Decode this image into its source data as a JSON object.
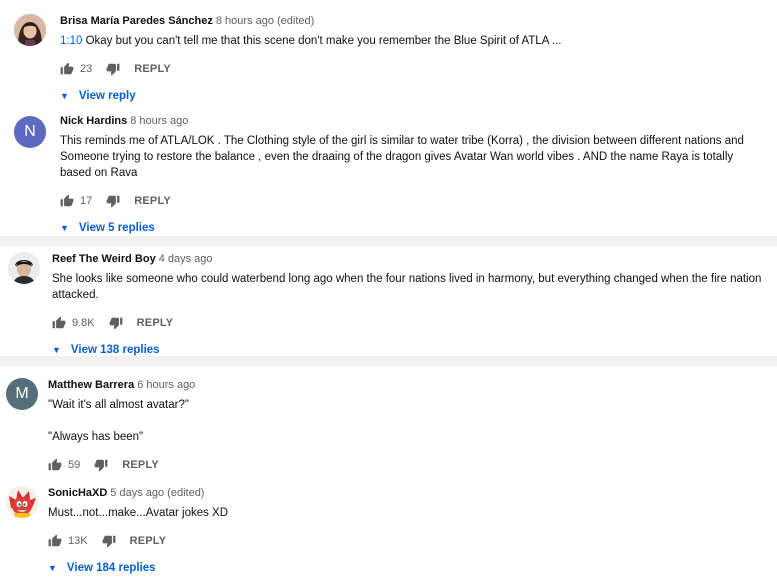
{
  "comments": [
    {
      "author": "Brisa María Paredes Sánchez",
      "time": "8 hours ago (edited)",
      "timestamp": "1:10",
      "text": "Okay but you can't tell me that this scene don't make you remember the Blue Spirit of ATLA ...",
      "likes": "23",
      "reply_label": "REPLY",
      "replies_label": "View reply"
    },
    {
      "author": "Nick Hardins",
      "avatar_letter": "N",
      "avatar_color": "#5c6bc0",
      "time": "8 hours ago",
      "text": "This reminds me of ATLA/LOK . The Clothing style of the girl is similar to water tribe (Korra) , the division between different nations and Someone trying to restore the balance , even the draaing of the dragon gives Avatar Wan world vibes . AND the name Raya is totally based on Rava",
      "likes": "17",
      "reply_label": "REPLY",
      "replies_label": "View 5 replies"
    },
    {
      "author": "Reef The Weird Boy",
      "time": "4 days ago",
      "text": "She looks like someone who could waterbend long ago when the four nations lived in harmony, but everything changed when the fire nation attacked.",
      "likes": "9.8K",
      "reply_label": "REPLY",
      "replies_label": "View 138 replies"
    },
    {
      "author": "Matthew Barrera",
      "avatar_letter": "M",
      "avatar_color": "#546e7a",
      "time": "6 hours ago",
      "line1": "\"Wait it's all almost avatar?\"",
      "line2": "\"Always has been\"",
      "likes": "59",
      "reply_label": "REPLY"
    },
    {
      "author": "SonicHaXD",
      "time": "5 days ago (edited)",
      "text": "Must...not...make...Avatar jokes XD",
      "likes": "13K",
      "reply_label": "REPLY",
      "replies_label": "View 184 replies"
    }
  ],
  "colors": {
    "link": "#065fd4",
    "secondary_text": "#606060",
    "separator": "#f1f1f1"
  }
}
